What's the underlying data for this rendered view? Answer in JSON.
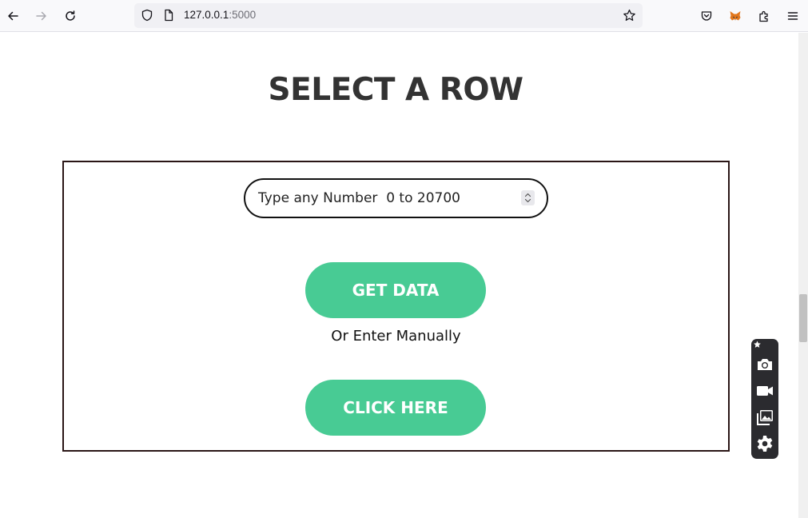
{
  "browser": {
    "url_host": "127.0.0.1",
    "url_port": ":5000"
  },
  "page": {
    "title": "SELECT A ROW",
    "number_input_placeholder": "Type any Number  0 to 20700",
    "get_data_label": "GET DATA",
    "or_text": "Or Enter Manually",
    "click_here_label": "CLICK HERE"
  },
  "colors": {
    "button": "#48cb94",
    "title": "#333333",
    "panel_border": "#2a1616"
  },
  "icons": {
    "toolbar": [
      "back-arrow-icon",
      "forward-arrow-icon",
      "reload-icon",
      "shield-icon",
      "page-icon",
      "bookmark-star-icon",
      "pocket-icon",
      "metamask-fox-icon",
      "extensions-icon",
      "menu-icon"
    ],
    "widget": [
      "pin-icon",
      "camera-icon",
      "video-camera-icon",
      "gallery-icon",
      "settings-gear-icon"
    ]
  }
}
